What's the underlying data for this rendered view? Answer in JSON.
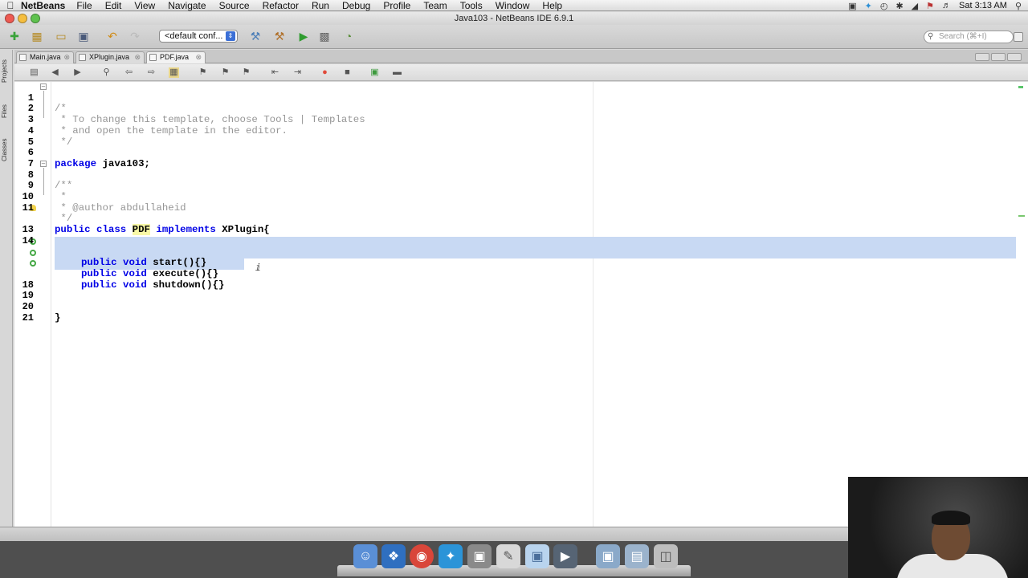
{
  "menubar": {
    "app_name": "NetBeans",
    "menus": [
      "File",
      "Edit",
      "View",
      "Navigate",
      "Source",
      "Refactor",
      "Run",
      "Debug",
      "Profile",
      "Team",
      "Tools",
      "Window",
      "Help"
    ],
    "clock": "Sat 3:13 AM"
  },
  "window": {
    "title": "Java103 - NetBeans IDE 6.9.1"
  },
  "toolbar": {
    "config_value": "<default conf...",
    "search_placeholder": "Search (⌘+I)"
  },
  "side_panel": {
    "tabs": [
      "Projects",
      "Files",
      "Classes"
    ]
  },
  "editor_tabs": [
    {
      "label": "Main.java",
      "active": false
    },
    {
      "label": "XPlugin.java",
      "active": false
    },
    {
      "label": "PDF.java",
      "active": true
    }
  ],
  "code": {
    "lines": [
      {
        "n": "1",
        "text": "/*"
      },
      {
        "n": "2",
        "text": " * To change this template, choose Tools | Templates"
      },
      {
        "n": "3",
        "text": " * and open the template in the editor."
      },
      {
        "n": "4",
        "text": " */"
      },
      {
        "n": "5",
        "text": ""
      },
      {
        "n": "6",
        "text": "package java103;"
      },
      {
        "n": "7",
        "text": ""
      },
      {
        "n": "8",
        "text": "/**"
      },
      {
        "n": "9",
        "text": " *"
      },
      {
        "n": "10",
        "text": " * @author abdullaheid"
      },
      {
        "n": "11",
        "text": " */"
      },
      {
        "n": "",
        "text": "public class PDF implements XPlugin{"
      },
      {
        "n": "13",
        "text": ""
      },
      {
        "n": "14",
        "text": ""
      },
      {
        "n": "",
        "text": "    public void start(){}"
      },
      {
        "n": "",
        "text": "    public void execute(){}"
      },
      {
        "n": "",
        "text": "    public void shutdown(){}"
      },
      {
        "n": "18",
        "text": ""
      },
      {
        "n": "19",
        "text": ""
      },
      {
        "n": "20",
        "text": "}"
      },
      {
        "n": "21",
        "text": ""
      }
    ],
    "tokens": {
      "l1": "/*",
      "l2": " * To change this template, choose Tools | Templates",
      "l3": " * and open the template in the editor.",
      "l4": " */",
      "l6_kw": "package",
      "l6_rest": " java103;",
      "l8": "/**",
      "l9": " *",
      "l10": " * @author abdullaheid",
      "l11": " */",
      "l12_kw1": "public class ",
      "l12_cls": "PDF",
      "l12_kw2": " implements ",
      "l12_rest": "XPlugin{",
      "l15_kw": "public void ",
      "l15_rest": "start(){}",
      "l16_kw": "public void ",
      "l16_rest": "execute(){}",
      "l17_kw": "public void ",
      "l17_rest": "shutdown(){}",
      "l20": "}"
    }
  },
  "colors": {
    "keyword": "#0000e6",
    "comment": "#969696",
    "selection": "#c8d9f3",
    "gutter_override": "#4caf50"
  }
}
